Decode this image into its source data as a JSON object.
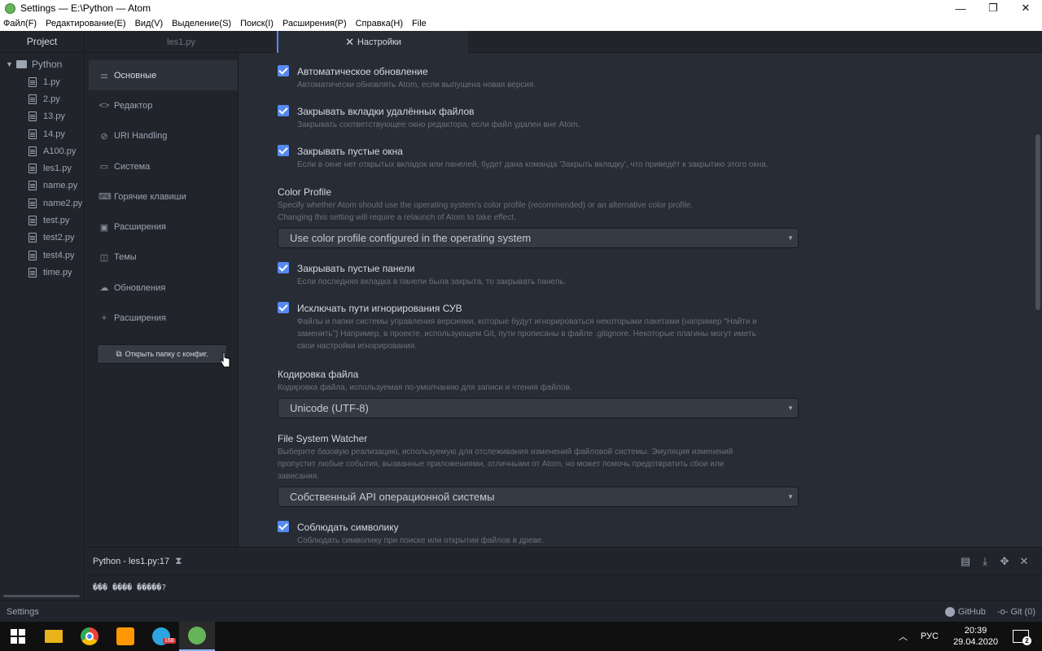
{
  "window": {
    "title": "Settings — E:\\Python — Atom",
    "minimize_glyph": "—",
    "restore_glyph": "❐",
    "close_glyph": "✕"
  },
  "menu": [
    "Файл(F)",
    "Редактирование(E)",
    "Вид(V)",
    "Выделение(S)",
    "Поиск(I)",
    "Расширения(P)",
    "Справка(H)",
    "File"
  ],
  "project": {
    "header": "Project",
    "root": "Python",
    "files": [
      "1.py",
      "2.py",
      "13.py",
      "14.py",
      "A100.py",
      "les1.py",
      "name.py",
      "name2.py",
      "test.py",
      "test2.py",
      "test4.py",
      "time.py"
    ]
  },
  "tabs": {
    "les1": "les1.py",
    "settings": "Настройки"
  },
  "settings_nav": {
    "items": [
      {
        "label": "Основные",
        "icon": "sliders-icon",
        "glyph": "⚌"
      },
      {
        "label": "Редактор",
        "icon": "code-icon",
        "glyph": "<>"
      },
      {
        "label": "URI Handling",
        "icon": "link-icon",
        "glyph": "⊘"
      },
      {
        "label": "Система",
        "icon": "monitor-icon",
        "glyph": "▭"
      },
      {
        "label": "Горячие клавиши",
        "icon": "keyboard-icon",
        "glyph": "⌨"
      },
      {
        "label": "Расширения",
        "icon": "package-icon",
        "glyph": "▣"
      },
      {
        "label": "Темы",
        "icon": "paintcan-icon",
        "glyph": "◫"
      },
      {
        "label": "Обновления",
        "icon": "cloud-download-icon",
        "glyph": "☁"
      },
      {
        "label": "Расширения",
        "icon": "plus-icon",
        "glyph": "+"
      }
    ],
    "open_config": "Открыть папку с конфиг."
  },
  "settings": {
    "auto_update": {
      "title": "Автоматическое обновление",
      "desc": "Автоматически обновлять Atom, если выпущена новая версия."
    },
    "close_deleted": {
      "title": "Закрывать вкладки удалённых файлов",
      "desc": "Закрывать соответствующее окно редактора, если файл удален вне Atom."
    },
    "close_empty_windows": {
      "title": "Закрывать пустые окна",
      "desc": "Если в окне нет открытых вкладок или панелей, будет дана команда 'Закрыть вкладку', что приведёт к закрытию этого окна."
    },
    "color_profile": {
      "title": "Color Profile",
      "desc1": "Specify whether Atom should use the operating system's color profile (recommended) or an alternative color profile.",
      "desc2": "Changing this setting will require a relaunch of Atom to take effect.",
      "value": "Use color profile configured in the operating system"
    },
    "close_empty_panes": {
      "title": "Закрывать пустые панели",
      "desc": "Если последняя вкладка в панели была закрыта, то закрывать панель."
    },
    "exclude_vcs": {
      "title": "Исключать пути игнорирования СУВ",
      "desc1": "Файлы и папки системы управления версиями, которые будут игнорироваться некоторыми пакетами (например \"Найти и",
      "desc2": "заменить\") Например, в проекте, использующем Git, пути прописаны в файле .gitignore. Некоторые плагины могут иметь",
      "desc3": "свои настройки игнорирования."
    },
    "file_encoding": {
      "title": "Кодировка файла",
      "desc": "Кодировка файла, используемая по-умолчанию для записи и чтения файлов.",
      "value": "Unicode (UTF-8)"
    },
    "fs_watcher": {
      "title": "File System Watcher",
      "desc1": "Выберите базовую реализацию, используемую для отслеживания изменений файловой системы. Эмуляция изменений",
      "desc2": "пропустит любые события, вызванные приложениями, отличными от Atom, но может помочь предотвратить сбои или",
      "desc3": "зависания.",
      "value": "Собственный API операционной системы"
    },
    "follow_symlinks": {
      "title": "Соблюдать символику",
      "desc": "Соблюдать символику при поиске или открытии файлов в древе."
    }
  },
  "bottom_panel": {
    "title": "Python - les1.py:17",
    "output": "��� ���� �����?"
  },
  "statusbar": {
    "left": "Settings",
    "github": "GitHub",
    "git": "Git (0)"
  },
  "taskbar": {
    "telegram_badge": "168",
    "lang": "РУС",
    "time": "20:39",
    "date": "29.04.2020",
    "notifications": "2"
  }
}
